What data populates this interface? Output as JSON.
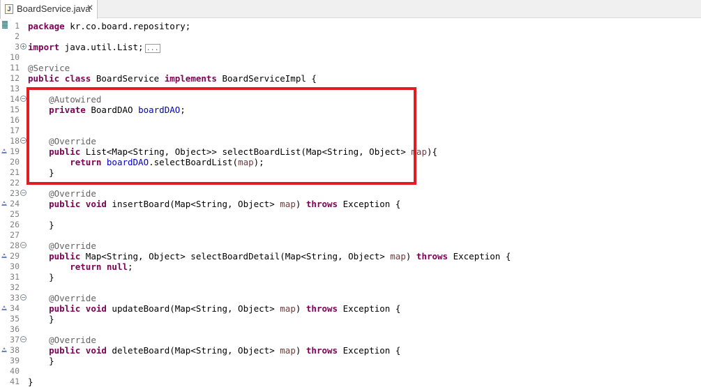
{
  "tab": {
    "icon": "J",
    "label": "BoardService.java",
    "close": "✕"
  },
  "lines": [
    {
      "n": "1",
      "tokens": [
        {
          "t": "package",
          "c": "kw"
        },
        {
          "t": " kr.co.board.repository;"
        }
      ]
    },
    {
      "n": "2",
      "tokens": []
    },
    {
      "n": "3",
      "fold": "+",
      "tokens": [
        {
          "t": "import",
          "c": "kw"
        },
        {
          "t": " java.util.List;"
        },
        {
          "t": "...",
          "c": "collapsed"
        }
      ]
    },
    {
      "n": "10",
      "tokens": []
    },
    {
      "n": "11",
      "tokens": [
        {
          "t": "@Service",
          "c": "an"
        }
      ]
    },
    {
      "n": "12",
      "tokens": [
        {
          "t": "public",
          "c": "kw"
        },
        {
          "t": " "
        },
        {
          "t": "class",
          "c": "kw"
        },
        {
          "t": " BoardService "
        },
        {
          "t": "implements",
          "c": "kw"
        },
        {
          "t": " BoardServiceImpl {"
        }
      ]
    },
    {
      "n": "13",
      "tokens": []
    },
    {
      "n": "14",
      "fold": "-",
      "tokens": [
        {
          "t": "    "
        },
        {
          "t": "@Autowired",
          "c": "an"
        }
      ]
    },
    {
      "n": "15",
      "tokens": [
        {
          "t": "    "
        },
        {
          "t": "private",
          "c": "kw"
        },
        {
          "t": " BoardDAO "
        },
        {
          "t": "boardDAO",
          "c": "fd"
        },
        {
          "t": ";"
        }
      ]
    },
    {
      "n": "16",
      "tokens": []
    },
    {
      "n": "17",
      "tokens": []
    },
    {
      "n": "18",
      "fold": "-",
      "tokens": [
        {
          "t": "    "
        },
        {
          "t": "@Override",
          "c": "an"
        }
      ]
    },
    {
      "n": "19",
      "override": true,
      "tokens": [
        {
          "t": "    "
        },
        {
          "t": "public",
          "c": "kw"
        },
        {
          "t": " List<Map<String, Object>> selectBoardList(Map<String, Object> "
        },
        {
          "t": "map",
          "c": "pm"
        },
        {
          "t": "){"
        }
      ]
    },
    {
      "n": "20",
      "tokens": [
        {
          "t": "        "
        },
        {
          "t": "return",
          "c": "kw"
        },
        {
          "t": " "
        },
        {
          "t": "boardDAO",
          "c": "fd"
        },
        {
          "t": ".selectBoardList("
        },
        {
          "t": "map",
          "c": "pm"
        },
        {
          "t": ");"
        }
      ]
    },
    {
      "n": "21",
      "tokens": [
        {
          "t": "    }"
        }
      ]
    },
    {
      "n": "22",
      "tokens": []
    },
    {
      "n": "23",
      "fold": "-",
      "tokens": [
        {
          "t": "    "
        },
        {
          "t": "@Override",
          "c": "an"
        }
      ]
    },
    {
      "n": "24",
      "override": true,
      "tokens": [
        {
          "t": "    "
        },
        {
          "t": "public",
          "c": "kw"
        },
        {
          "t": " "
        },
        {
          "t": "void",
          "c": "kw"
        },
        {
          "t": " insertBoard(Map<String, Object> "
        },
        {
          "t": "map",
          "c": "pm"
        },
        {
          "t": ") "
        },
        {
          "t": "throws",
          "c": "kw"
        },
        {
          "t": " Exception {"
        }
      ]
    },
    {
      "n": "25",
      "tokens": []
    },
    {
      "n": "26",
      "tokens": [
        {
          "t": "    }"
        }
      ]
    },
    {
      "n": "27",
      "tokens": []
    },
    {
      "n": "28",
      "fold": "-",
      "tokens": [
        {
          "t": "    "
        },
        {
          "t": "@Override",
          "c": "an"
        }
      ]
    },
    {
      "n": "29",
      "override": true,
      "tokens": [
        {
          "t": "    "
        },
        {
          "t": "public",
          "c": "kw"
        },
        {
          "t": " Map<String, Object> selectBoardDetail(Map<String, Object> "
        },
        {
          "t": "map",
          "c": "pm"
        },
        {
          "t": ") "
        },
        {
          "t": "throws",
          "c": "kw"
        },
        {
          "t": " Exception {"
        }
      ]
    },
    {
      "n": "30",
      "tokens": [
        {
          "t": "        "
        },
        {
          "t": "return",
          "c": "kw"
        },
        {
          "t": " "
        },
        {
          "t": "null",
          "c": "kw"
        },
        {
          "t": ";"
        }
      ]
    },
    {
      "n": "31",
      "tokens": [
        {
          "t": "    }"
        }
      ]
    },
    {
      "n": "32",
      "tokens": []
    },
    {
      "n": "33",
      "fold": "-",
      "tokens": [
        {
          "t": "    "
        },
        {
          "t": "@Override",
          "c": "an"
        }
      ]
    },
    {
      "n": "34",
      "override": true,
      "tokens": [
        {
          "t": "    "
        },
        {
          "t": "public",
          "c": "kw"
        },
        {
          "t": " "
        },
        {
          "t": "void",
          "c": "kw"
        },
        {
          "t": " updateBoard(Map<String, Object> "
        },
        {
          "t": "map",
          "c": "pm"
        },
        {
          "t": ") "
        },
        {
          "t": "throws",
          "c": "kw"
        },
        {
          "t": " Exception {"
        }
      ]
    },
    {
      "n": "35",
      "tokens": [
        {
          "t": "    }"
        }
      ]
    },
    {
      "n": "36",
      "tokens": []
    },
    {
      "n": "37",
      "fold": "-",
      "tokens": [
        {
          "t": "    "
        },
        {
          "t": "@Override",
          "c": "an"
        }
      ]
    },
    {
      "n": "38",
      "override": true,
      "tokens": [
        {
          "t": "    "
        },
        {
          "t": "public",
          "c": "kw"
        },
        {
          "t": " "
        },
        {
          "t": "void",
          "c": "kw"
        },
        {
          "t": " deleteBoard(Map<String, Object> "
        },
        {
          "t": "map",
          "c": "pm"
        },
        {
          "t": ") "
        },
        {
          "t": "throws",
          "c": "kw"
        },
        {
          "t": " Exception {"
        }
      ]
    },
    {
      "n": "39",
      "tokens": [
        {
          "t": "    }"
        }
      ]
    },
    {
      "n": "40",
      "tokens": []
    },
    {
      "n": "41",
      "tokens": [
        {
          "t": "}"
        }
      ]
    }
  ],
  "highlight_lines": [
    "14",
    "22"
  ]
}
